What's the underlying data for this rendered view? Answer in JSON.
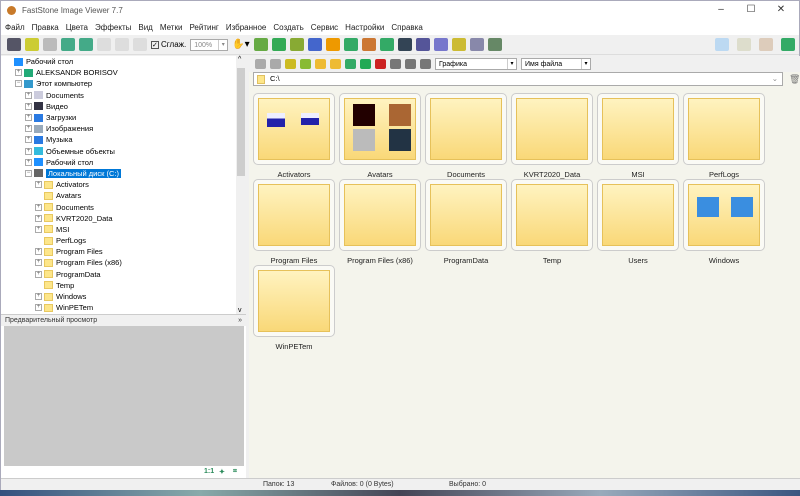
{
  "title": "FastStone Image Viewer 7.7",
  "menu": [
    "Файл",
    "Правка",
    "Цвета",
    "Эффекты",
    "Вид",
    "Метки",
    "Рейтинг",
    "Избранное",
    "Создать",
    "Сервис",
    "Настройки",
    "Справка"
  ],
  "toolbar": {
    "smooth_label": "Сглаж.",
    "zoom_value": "100%"
  },
  "nav": {
    "filter_value": "Графика",
    "sort_value": "Имя файла",
    "address": "C:\\"
  },
  "tree": {
    "root": "Рабочий стол",
    "user": "ALEKSANDR BORISOV",
    "computer": "Этот компьютер",
    "computer_items": [
      "Documents",
      "Видео",
      "Загрузки",
      "Изображения",
      "Музыка",
      "Объемные объекты",
      "Рабочий стол"
    ],
    "drive": "Локальный диск (C:)",
    "folders": [
      "Activators",
      "Avatars",
      "Documents",
      "KVRT2020_Data",
      "MSI",
      "PerfLogs",
      "Program Files",
      "Program Files (x86)",
      "ProgramData",
      "Temp",
      "Windows",
      "WinPETem"
    ]
  },
  "preview": {
    "title": "Предварительный просмотр",
    "ratio": "1:1"
  },
  "thumbnails": [
    "Activators",
    "Avatars",
    "Documents",
    "KVRT2020_Data",
    "MSI",
    "PerfLogs",
    "Program Files",
    "Program Files (x86)",
    "ProgramData",
    "Temp",
    "Users",
    "Windows",
    "WinPETem"
  ],
  "status": {
    "folders": "Папок: 13",
    "files": "Файлов: 0 (0 Bytes)",
    "selected": "Выбрано: 0"
  }
}
